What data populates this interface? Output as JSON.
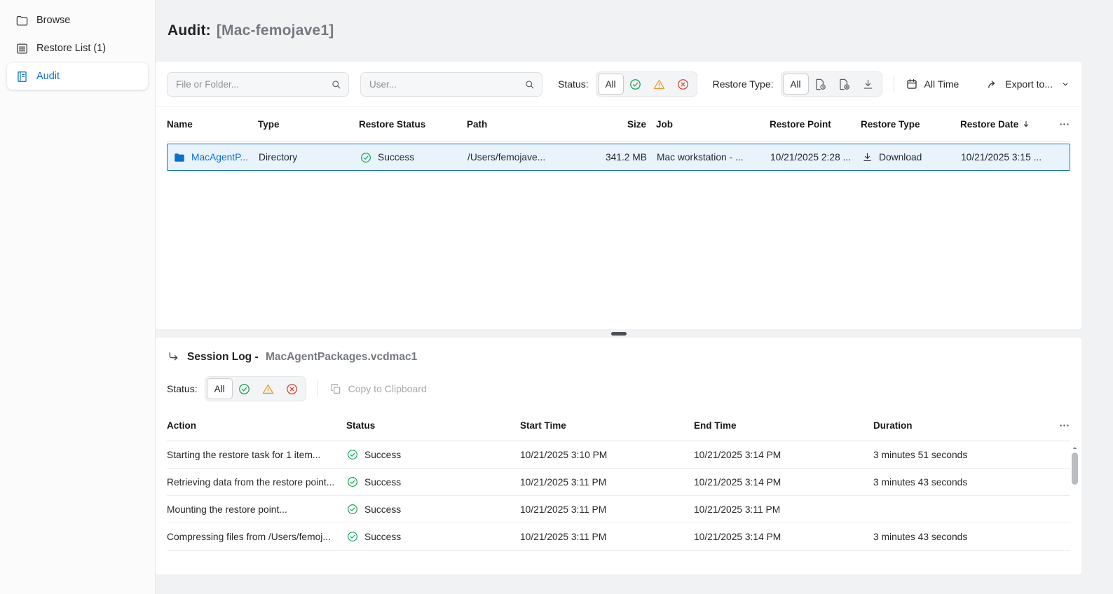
{
  "sidebar": {
    "items": [
      {
        "label": "Browse"
      },
      {
        "label": "Restore List (1)"
      },
      {
        "label": "Audit"
      }
    ]
  },
  "header": {
    "title_prefix": "Audit:",
    "title_target": "[Mac-femojave1]"
  },
  "toolbar": {
    "file_search_placeholder": "File or Folder...",
    "user_search_placeholder": "User...",
    "status_label": "Status:",
    "status_all_label": "All",
    "restore_type_label": "Restore Type:",
    "restore_type_all_label": "All",
    "time_filter_label": "All Time",
    "export_label": "Export to..."
  },
  "audit_table": {
    "columns": [
      "Name",
      "Type",
      "Restore Status",
      "Path",
      "Size",
      "Job",
      "Restore Point",
      "Restore Type",
      "Restore Date"
    ],
    "rows": [
      {
        "name": "MacAgentP...",
        "type": "Directory",
        "restore_status": "Success",
        "path": "/Users/femojave...",
        "size": "341.2 MB",
        "job": "Mac workstation - ...",
        "restore_point": "10/21/2025 2:28 ...",
        "restore_type": "Download",
        "restore_date": "10/21/2025 3:15 ..."
      }
    ]
  },
  "session_log": {
    "title_prefix": "Session Log -",
    "title_name": "MacAgentPackages.vcdmac1",
    "status_label": "Status:",
    "status_all_label": "All",
    "copy_label": "Copy to Clipboard",
    "columns": [
      "Action",
      "Status",
      "Start Time",
      "End Time",
      "Duration"
    ],
    "rows": [
      {
        "action": "Starting the restore task for 1 item...",
        "status": "Success",
        "start_time": "10/21/2025 3:10 PM",
        "end_time": "10/21/2025 3:14 PM",
        "duration": "3 minutes 51 seconds"
      },
      {
        "action": "Retrieving data from the restore point...",
        "status": "Success",
        "start_time": "10/21/2025 3:11 PM",
        "end_time": "10/21/2025 3:14 PM",
        "duration": "3 minutes 43 seconds"
      },
      {
        "action": "Mounting the restore point...",
        "status": "Success",
        "start_time": "10/21/2025 3:11 PM",
        "end_time": "10/21/2025 3:11 PM",
        "duration": ""
      },
      {
        "action": "Compressing files from /Users/femoj...",
        "status": "Success",
        "start_time": "10/21/2025 3:11 PM",
        "end_time": "10/21/2025 3:14 PM",
        "duration": "3 minutes 43 seconds"
      }
    ]
  },
  "colors": {
    "accent_blue": "#0b6fd0",
    "success_green": "#12a356",
    "warning_orange": "#e9992f",
    "error_red": "#df4330",
    "selected_row_bg": "#e9f3fc",
    "selected_row_border": "#1673c6"
  }
}
